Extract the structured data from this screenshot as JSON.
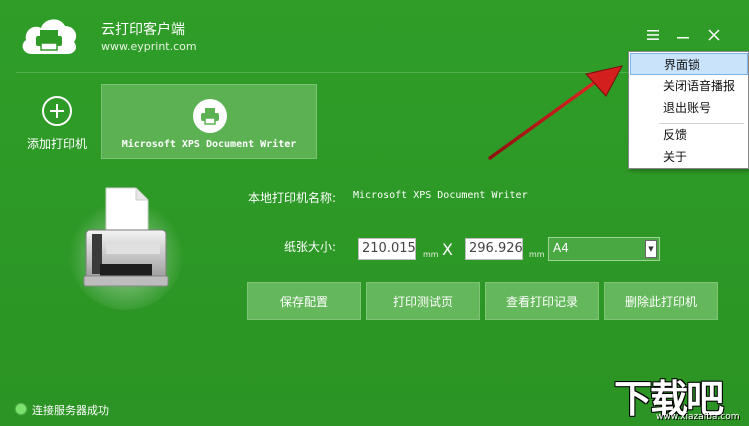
{
  "app": {
    "title": "云打印客户端",
    "url": "www.eyprint.com"
  },
  "window_controls": {
    "menu_icon": "hamburger-icon",
    "minimize_icon": "minimize-icon",
    "close_icon": "close-icon"
  },
  "printers": {
    "add_label": "添加打印机",
    "items": [
      {
        "label": "Microsoft XPS Document Writer",
        "selected": true
      }
    ]
  },
  "form": {
    "printer_name_label": "本地打印机名称:",
    "printer_name_value": "Microsoft XPS Document Writer",
    "paper_size_label": "纸张大小:",
    "width_value": "210.015",
    "height_value": "296.926",
    "unit": "mm",
    "times": "X",
    "paper_select": "A4"
  },
  "actions": {
    "save": "保存配置",
    "print_test": "打印测试页",
    "view_records": "查看打印记录",
    "delete_printer": "删除此打印机"
  },
  "status": {
    "text": "连接服务器成功",
    "color": "#7be36b"
  },
  "menu": {
    "items": [
      {
        "label": "界面锁",
        "active": true
      },
      {
        "label": "关闭语音播报",
        "active": false
      },
      {
        "label": "退出账号",
        "active": false
      },
      {
        "label": "反馈",
        "active": false
      },
      {
        "label": "关于",
        "active": false
      }
    ]
  },
  "watermark": {
    "text": "下载吧",
    "url": "www.xiazaiba.com"
  },
  "colors": {
    "background": "#2f9a26",
    "card": "#5cb253",
    "button": "#64b85b",
    "menu_highlight": "#c9e3fb",
    "arrow": "#c61d1d"
  }
}
